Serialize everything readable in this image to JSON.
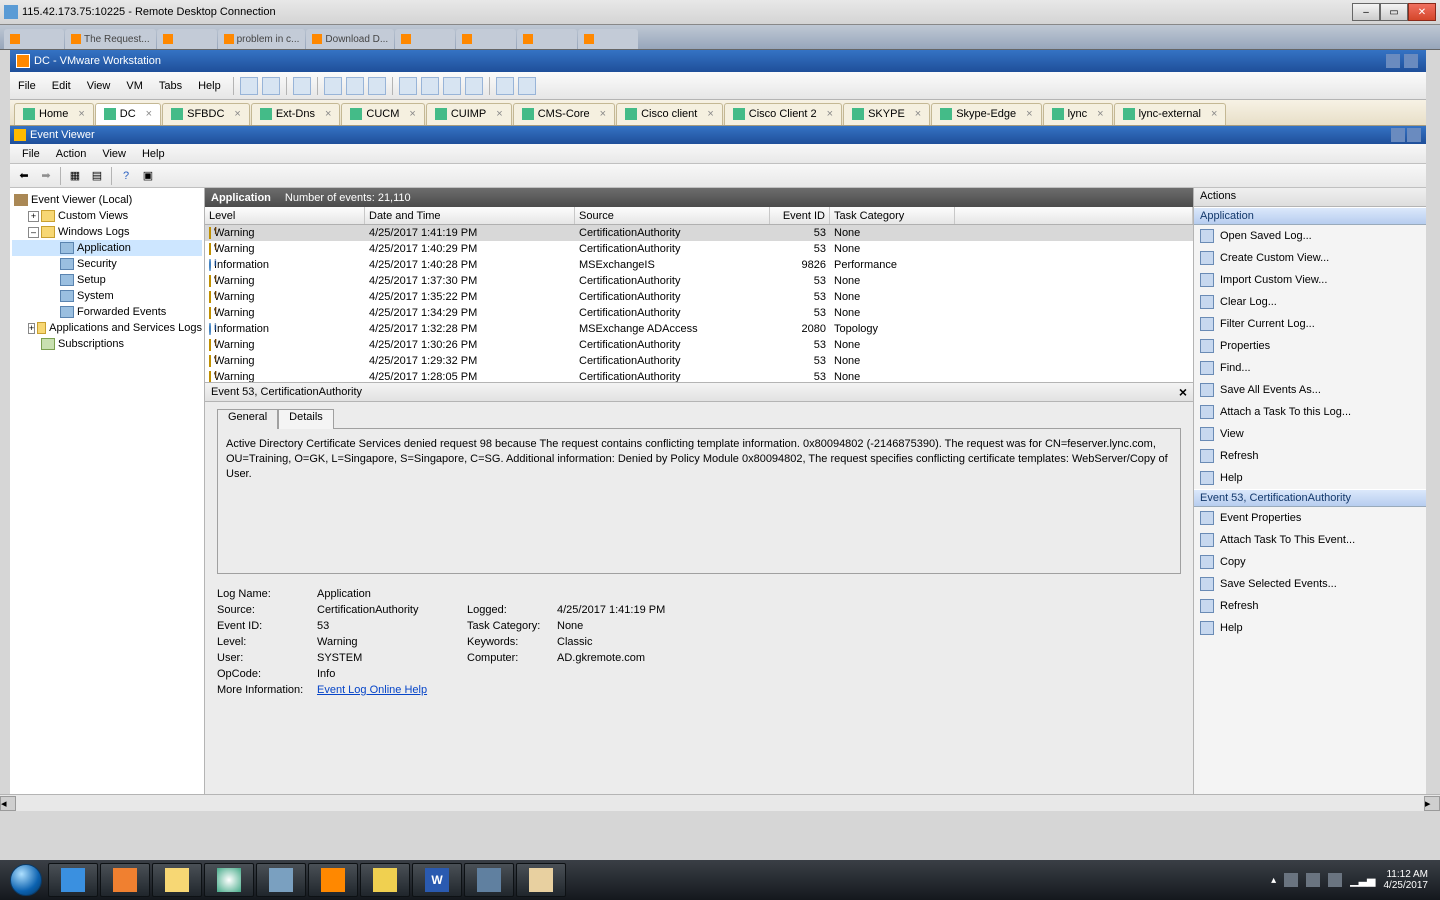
{
  "rdp": {
    "title": "115.42.173.75:10225 - Remote Desktop Connection"
  },
  "browser_tabs": [
    "",
    "The Request...",
    "",
    "problem in c...",
    "Download D...",
    "",
    "",
    "",
    ""
  ],
  "vmware": {
    "title": "DC - VMware Workstation",
    "menu": [
      "File",
      "Edit",
      "View",
      "VM",
      "Tabs",
      "Help"
    ],
    "tabs": [
      "Home",
      "DC",
      "SFBDC",
      "Ext-Dns",
      "CUCM",
      "CUIMP",
      "CMS-Core",
      "Cisco client",
      "Cisco Client 2",
      "SKYPE",
      "Skype-Edge",
      "lync",
      "lync-external"
    ],
    "active_tab": 1
  },
  "eventviewer": {
    "title": "Event Viewer",
    "menu": [
      "File",
      "Action",
      "View",
      "Help"
    ],
    "tree": {
      "root": "Event Viewer (Local)",
      "custom": "Custom Views",
      "winlogs": "Windows Logs",
      "application": "Application",
      "security": "Security",
      "setup": "Setup",
      "system": "System",
      "forwarded": "Forwarded Events",
      "appsvc": "Applications and Services Logs",
      "subs": "Subscriptions"
    },
    "main_title": "Application",
    "main_count": "Number of events: 21,110",
    "columns": {
      "level": "Level",
      "date": "Date and Time",
      "source": "Source",
      "eid": "Event ID",
      "cat": "Task Category"
    },
    "events": [
      {
        "lv": "Warning",
        "dt": "4/25/2017 1:41:19 PM",
        "src": "CertificationAuthority",
        "id": "53",
        "cat": "None"
      },
      {
        "lv": "Warning",
        "dt": "4/25/2017 1:40:29 PM",
        "src": "CertificationAuthority",
        "id": "53",
        "cat": "None"
      },
      {
        "lv": "Information",
        "dt": "4/25/2017 1:40:28 PM",
        "src": "MSExchangeIS",
        "id": "9826",
        "cat": "Performance"
      },
      {
        "lv": "Warning",
        "dt": "4/25/2017 1:37:30 PM",
        "src": "CertificationAuthority",
        "id": "53",
        "cat": "None"
      },
      {
        "lv": "Warning",
        "dt": "4/25/2017 1:35:22 PM",
        "src": "CertificationAuthority",
        "id": "53",
        "cat": "None"
      },
      {
        "lv": "Warning",
        "dt": "4/25/2017 1:34:29 PM",
        "src": "CertificationAuthority",
        "id": "53",
        "cat": "None"
      },
      {
        "lv": "Information",
        "dt": "4/25/2017 1:32:28 PM",
        "src": "MSExchange ADAccess",
        "id": "2080",
        "cat": "Topology"
      },
      {
        "lv": "Warning",
        "dt": "4/25/2017 1:30:26 PM",
        "src": "CertificationAuthority",
        "id": "53",
        "cat": "None"
      },
      {
        "lv": "Warning",
        "dt": "4/25/2017 1:29:32 PM",
        "src": "CertificationAuthority",
        "id": "53",
        "cat": "None"
      },
      {
        "lv": "Warning",
        "dt": "4/25/2017 1:28:05 PM",
        "src": "CertificationAuthority",
        "id": "53",
        "cat": "None"
      }
    ],
    "detail": {
      "title": "Event 53, CertificationAuthority",
      "tabs": {
        "general": "General",
        "details": "Details"
      },
      "message": "Active Directory Certificate Services denied request 98 because The request contains conflicting template information. 0x80094802 (-2146875390).  The request was for CN=feserver.lync.com, OU=Training, O=GK, L=Singapore, S=Singapore, C=SG.  Additional information: Denied by Policy Module  0x80094802, The request specifies conflicting certificate templates: WebServer/Copy of User.",
      "labels": {
        "logname": "Log Name:",
        "source": "Source:",
        "eventid": "Event ID:",
        "level": "Level:",
        "user": "User:",
        "opcode": "OpCode:",
        "moreinfo": "More Information:",
        "logged": "Logged:",
        "taskcat": "Task Category:",
        "keywords": "Keywords:",
        "computer": "Computer:"
      },
      "values": {
        "logname": "Application",
        "source": "CertificationAuthority",
        "eventid": "53",
        "level": "Warning",
        "user": "SYSTEM",
        "opcode": "Info",
        "logged": "4/25/2017 1:41:19 PM",
        "taskcat": "None",
        "keywords": "Classic",
        "computer": "AD.gkremote.com",
        "link": "Event Log Online Help"
      }
    },
    "actions": {
      "hdr": "Actions",
      "sec1": "Application",
      "items1": [
        "Open Saved Log...",
        "Create Custom View...",
        "Import Custom View...",
        "Clear Log...",
        "Filter Current Log...",
        "Properties",
        "Find...",
        "Save All Events As...",
        "Attach a Task To this Log...",
        "View",
        "Refresh",
        "Help"
      ],
      "sec2": "Event 53, CertificationAuthority",
      "items2": [
        "Event Properties",
        "Attach Task To This Event...",
        "Copy",
        "Save Selected Events...",
        "Refresh",
        "Help"
      ]
    }
  },
  "taskbar": {
    "time": "11:12 AM",
    "date": "4/25/2017"
  }
}
